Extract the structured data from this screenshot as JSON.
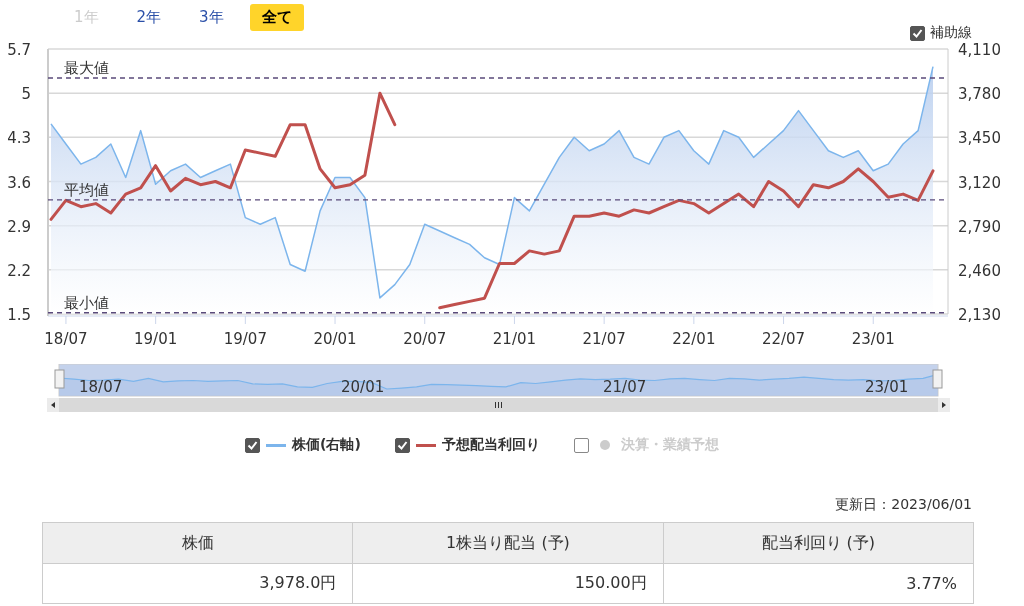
{
  "range_buttons": [
    {
      "label": "1年",
      "selected": false,
      "disabled": true
    },
    {
      "label": "2年",
      "selected": false,
      "disabled": false
    },
    {
      "label": "3年",
      "selected": false,
      "disabled": false
    },
    {
      "label": "全て",
      "selected": true,
      "disabled": false
    }
  ],
  "guide_toggle": {
    "label": "補助線",
    "checked": true
  },
  "chart": {
    "chart_data": {
      "type": "line",
      "categories": [
        null,
        "18/07",
        null,
        null,
        null,
        null,
        null,
        "19/01",
        null,
        null,
        null,
        null,
        null,
        "19/07",
        null,
        null,
        null,
        null,
        null,
        "20/01",
        null,
        null,
        null,
        null,
        null,
        "20/07",
        null,
        null,
        null,
        null,
        null,
        "21/01",
        null,
        null,
        null,
        null,
        null,
        "21/07",
        null,
        null,
        null,
        null,
        null,
        "22/01",
        null,
        null,
        null,
        null,
        null,
        "22/07",
        null,
        null,
        null,
        null,
        null,
        "23/01",
        null,
        null,
        null,
        null
      ],
      "series": [
        {
          "name": "株価(右軸)",
          "color": "#7cb5ec",
          "axis": "y2",
          "type": "area",
          "values": [
            3550,
            3400,
            3250,
            3300,
            3400,
            3150,
            3500,
            3100,
            3200,
            3250,
            3150,
            3200,
            3250,
            2850,
            2800,
            2850,
            2500,
            2450,
            2900,
            3150,
            3150,
            3000,
            2250,
            2350,
            2500,
            2800,
            2750,
            2700,
            2650,
            2550,
            2500,
            3000,
            2900,
            3100,
            3300,
            3450,
            3350,
            3400,
            3500,
            3300,
            3250,
            3450,
            3500,
            3350,
            3250,
            3500,
            3450,
            3300,
            3400,
            3500,
            3650,
            3500,
            3350,
            3300,
            3350,
            3200,
            3250,
            3400,
            3500,
            3978
          ]
        },
        {
          "name": "予想配当利回り",
          "color": "#c0504d",
          "values": [
            3.0,
            3.3,
            3.2,
            3.25,
            3.1,
            3.4,
            3.5,
            3.85,
            3.45,
            3.65,
            3.55,
            3.6,
            3.5,
            4.1,
            4.05,
            4.0,
            4.5,
            4.5,
            3.8,
            3.5,
            3.55,
            3.7,
            5.0,
            4.5,
            null,
            null,
            1.6,
            1.65,
            1.7,
            1.75,
            2.3,
            2.3,
            2.5,
            2.45,
            2.5,
            3.05,
            3.05,
            3.1,
            3.05,
            3.15,
            3.1,
            3.2,
            3.3,
            3.25,
            3.1,
            3.25,
            3.4,
            3.2,
            3.6,
            3.45,
            3.2,
            3.55,
            3.5,
            3.6,
            3.8,
            3.6,
            3.35,
            3.4,
            3.3,
            3.77
          ]
        }
      ],
      "ylim": [
        1.5,
        5.7
      ],
      "yticks": [
        1.5,
        2.2,
        2.9,
        3.6,
        4.3,
        5,
        5.7
      ],
      "y2lim": [
        2130,
        4110
      ],
      "y2ticks": [
        {
          "value": 2130,
          "label": "2,130"
        },
        {
          "value": 2460,
          "label": "2,460"
        },
        {
          "value": 2790,
          "label": "2,790"
        },
        {
          "value": 3120,
          "label": "3,120"
        },
        {
          "value": 3450,
          "label": "3,450"
        },
        {
          "value": 3780,
          "label": "3,780"
        },
        {
          "value": 4110,
          "label": "4,110"
        }
      ],
      "grid": true,
      "ref_lines": [
        {
          "axis": "y",
          "value": 5.24,
          "label": "最大値"
        },
        {
          "axis": "y",
          "value": 3.31,
          "label": "平均値"
        },
        {
          "axis": "y",
          "value": 1.52,
          "label": "最小値"
        }
      ]
    }
  },
  "navigator": {
    "labels": [
      "18/07",
      "20/01",
      "21/07",
      "23/01"
    ]
  },
  "legend": [
    {
      "checked": true,
      "kind": "line",
      "disabled": false
    },
    {
      "checked": true,
      "kind": "line",
      "disabled": false
    },
    {
      "label": "決算・業績予想",
      "checked": false,
      "kind": "dot",
      "color": "#cccccc",
      "disabled": true
    }
  ],
  "updated": "更新日：2023/06/01",
  "table": {
    "columns": [
      "株価",
      "1株当り配当 (予)",
      "配当利回り (予)"
    ],
    "rows": [
      [
        "3,978.0円",
        "150.00円",
        "3.77%"
      ]
    ]
  }
}
